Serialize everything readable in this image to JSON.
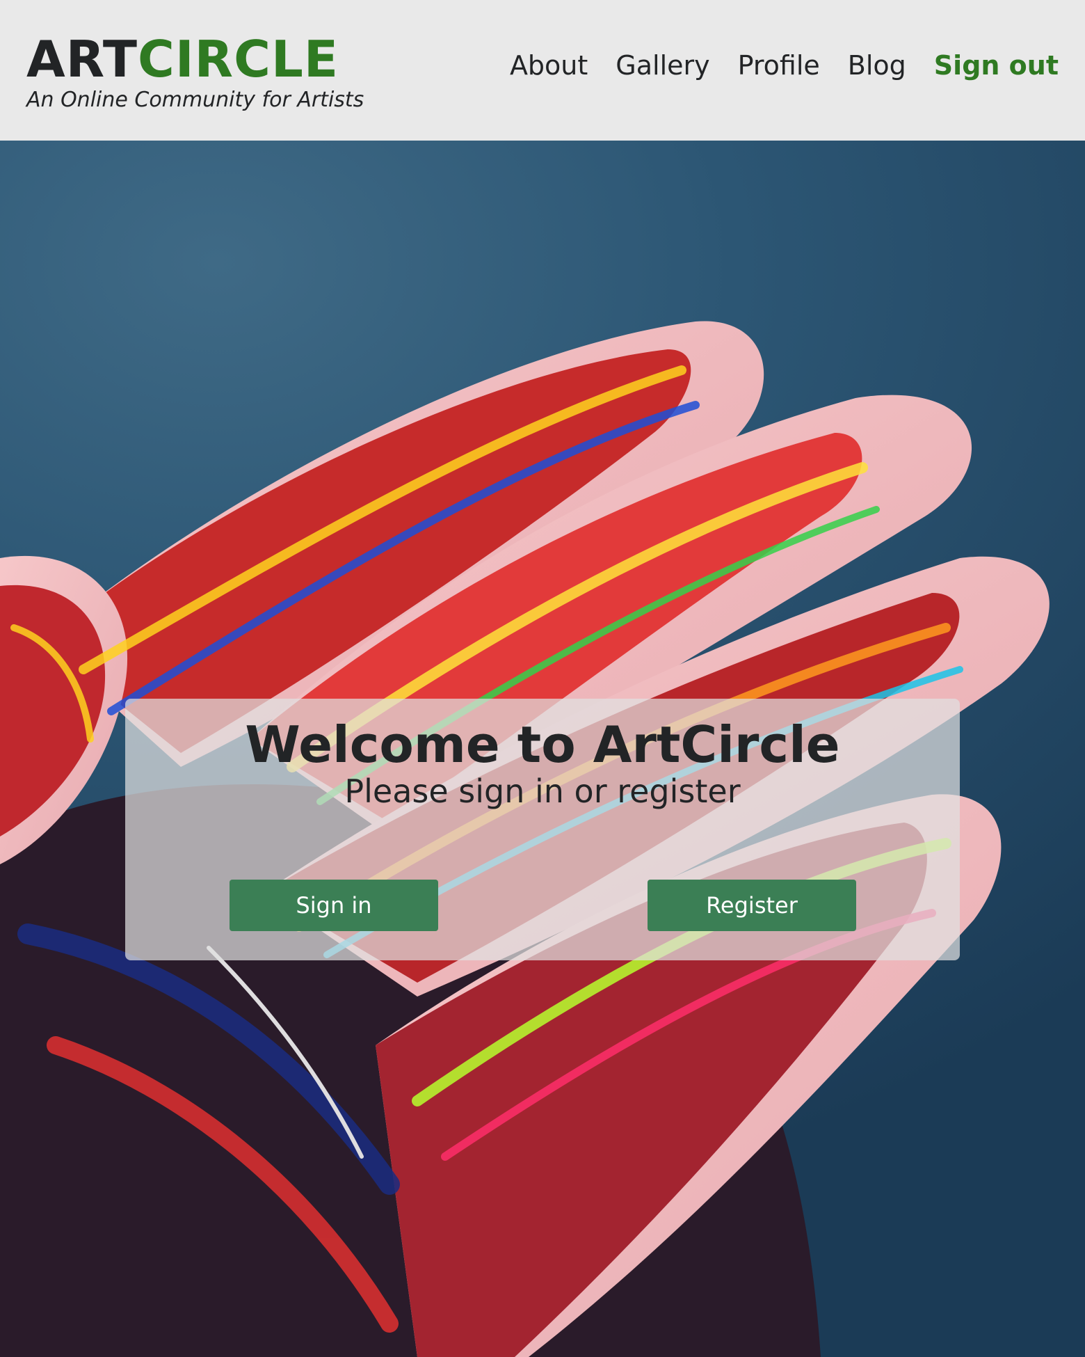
{
  "brand": {
    "logo_part1": "ART",
    "logo_part2": "CIRCLE",
    "tagline": "An Online Community for Artists",
    "dark_color": "#222426",
    "green_color": "#2f7a22"
  },
  "nav": {
    "items": [
      {
        "label": "About"
      },
      {
        "label": "Gallery"
      },
      {
        "label": "Profile"
      },
      {
        "label": "Blog"
      },
      {
        "label": "Sign out"
      }
    ]
  },
  "hero": {
    "image": "paint-covered-hand-photo",
    "title": "Welcome to ArtCircle",
    "subtitle": "Please sign in or register",
    "signin_label": "Sign in",
    "register_label": "Register",
    "button_color": "#3b7f55"
  }
}
